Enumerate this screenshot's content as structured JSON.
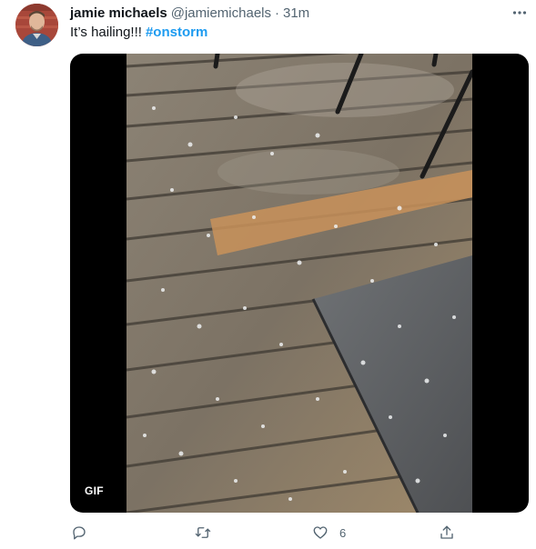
{
  "tweet": {
    "author_name": "jamie michaels",
    "author_handle": "@jamiemichaels",
    "separator": "·",
    "time": "31m",
    "text": "It’s hailing!!!",
    "hashtag": "#onstorm",
    "avatar_icon": "user-avatar-photo",
    "more_icon": "more-horizontal-icon"
  },
  "media": {
    "badge": "GIF",
    "description_icon": "hail-on-deck-gif"
  },
  "actions": {
    "reply_icon": "reply-icon",
    "retweet_icon": "retweet-icon",
    "like_icon": "heart-icon",
    "like_count": "6",
    "share_icon": "share-icon"
  },
  "colors": {
    "link": "#1d9bf0",
    "secondary_text": "#536471",
    "primary_text": "#0f1419"
  }
}
